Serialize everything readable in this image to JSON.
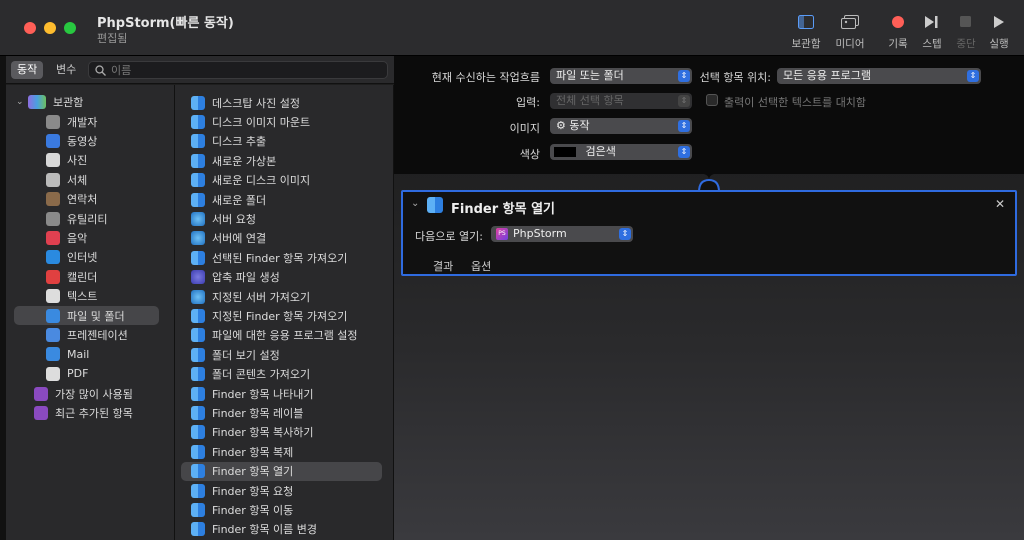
{
  "window": {
    "title": "PhpStorm(빠른 동작)",
    "subtitle": "편집됨"
  },
  "toolbar": {
    "library": "보관함",
    "media": "미디어",
    "record": "기록",
    "step": "스텝",
    "stop": "중단",
    "run": "실행"
  },
  "colors": {
    "accent": "#2f6be0",
    "record": "#ff5f57"
  },
  "search": {
    "seg_actions": "동작",
    "seg_vars": "변수",
    "placeholder": "이름"
  },
  "library": {
    "root": "보관함",
    "items": [
      "개발자",
      "동영상",
      "사진",
      "서체",
      "연락처",
      "유틸리티",
      "음악",
      "인터넷",
      "캘린더",
      "텍스트",
      "파일 및 폴더",
      "프레젠테이션",
      "Mail",
      "PDF"
    ],
    "extra": [
      "가장 많이 사용됨",
      "최근 추가된 항목"
    ]
  },
  "actions": [
    "데스크탑 사진 설정",
    "디스크 이미지 마운트",
    "디스크 추출",
    "새로운 가상본",
    "새로운 디스크 이미지",
    "새로운 폴더",
    "서버 요청",
    "서버에 연결",
    "선택된 Finder 항목 가져오기",
    "압축 파일 생성",
    "지정된 서버 가져오기",
    "지정된 Finder 항목 가져오기",
    "파일에 대한 응용 프로그램 설정",
    "폴더 보기 설정",
    "폴더 콘텐츠 가져오기",
    "Finder 항목 나타내기",
    "Finder 항목 레이블",
    "Finder 항목 복사하기",
    "Finder 항목 복제",
    "Finder 항목 열기",
    "Finder 항목 요청",
    "Finder 항목 이동",
    "Finder 항목 이름 변경"
  ],
  "workflow": {
    "receives_label": "현재 수신하는 작업흐름",
    "receives_value": "파일 또는 폴더",
    "in_label": "선택 항목 위치:",
    "in_value": "모든 응용 프로그램",
    "input_label": "입력:",
    "input_value": "전체 선택 항목",
    "replace_label": "출력이 선택한 텍스트를 대치함",
    "image_label": "이미지",
    "image_value": "⚙ 동작",
    "color_label": "색상",
    "color_value": "검은색"
  },
  "card": {
    "title": "Finder 항목 열기",
    "open_with_label": "다음으로 열기:",
    "open_with_value": "PhpStorm",
    "tab_results": "결과",
    "tab_options": "옵션"
  }
}
